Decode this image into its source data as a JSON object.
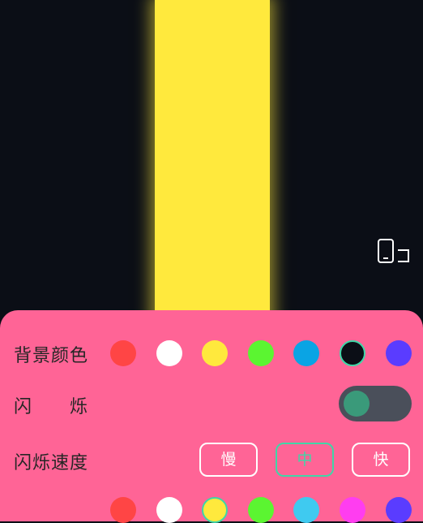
{
  "bg_row": {
    "label": "背景颜色",
    "selected": "#0b0e16",
    "swatches": [
      "#ff4545",
      "#ffffff",
      "#ffe93d",
      "#5bf531",
      "#0aa4e4",
      "#0b0e16",
      "#5a3cff"
    ]
  },
  "flash_row": {
    "label": "闪　　烁",
    "enabled": false
  },
  "speed_row": {
    "label": "闪烁速度",
    "options": [
      "慢",
      "中",
      "快"
    ],
    "selected": "中"
  },
  "light_row": {
    "selected": "#ffe93d",
    "swatches": [
      "#ff4545",
      "#ffffff",
      "#ffe93d",
      "#5bf531",
      "#3fcaf0",
      "#ff3df0",
      "#5a3cff"
    ]
  },
  "colors": {
    "panel": "#ff6496",
    "light": "#ffe93d",
    "accent": "#3fd6a7",
    "screen": "#0b0e16"
  },
  "icons": {
    "rotate": "rotate-screen-icon"
  }
}
